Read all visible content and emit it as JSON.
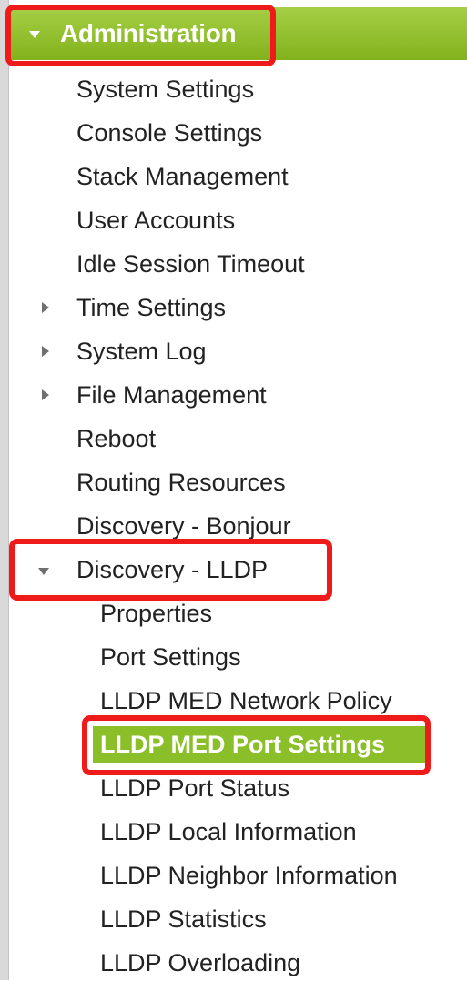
{
  "colors": {
    "header_green": "#8fbf28",
    "selected_green": "#8bbf2a",
    "highlight_red": "#ef1b1b",
    "text": "#222222"
  },
  "nav": {
    "section_title": "Administration",
    "items": [
      {
        "label": "System Settings",
        "expandable": false
      },
      {
        "label": "Console Settings",
        "expandable": false
      },
      {
        "label": "Stack Management",
        "expandable": false
      },
      {
        "label": "User Accounts",
        "expandable": false
      },
      {
        "label": "Idle Session Timeout",
        "expandable": false
      },
      {
        "label": "Time Settings",
        "expandable": true,
        "expanded": false
      },
      {
        "label": "System Log",
        "expandable": true,
        "expanded": false
      },
      {
        "label": "File Management",
        "expandable": true,
        "expanded": false
      },
      {
        "label": "Reboot",
        "expandable": false
      },
      {
        "label": "Routing Resources",
        "expandable": false
      },
      {
        "label": "Discovery - Bonjour",
        "expandable": false
      },
      {
        "label": "Discovery - LLDP",
        "expandable": true,
        "expanded": true
      }
    ],
    "lldp_children": [
      {
        "label": "Properties"
      },
      {
        "label": "Port Settings"
      },
      {
        "label": "LLDP MED Network Policy"
      },
      {
        "label": "LLDP MED Port Settings",
        "selected": true
      },
      {
        "label": "LLDP Port Status"
      },
      {
        "label": "LLDP Local Information"
      },
      {
        "label": "LLDP Neighbor Information"
      },
      {
        "label": "LLDP Statistics"
      },
      {
        "label": "LLDP Overloading"
      }
    ]
  }
}
